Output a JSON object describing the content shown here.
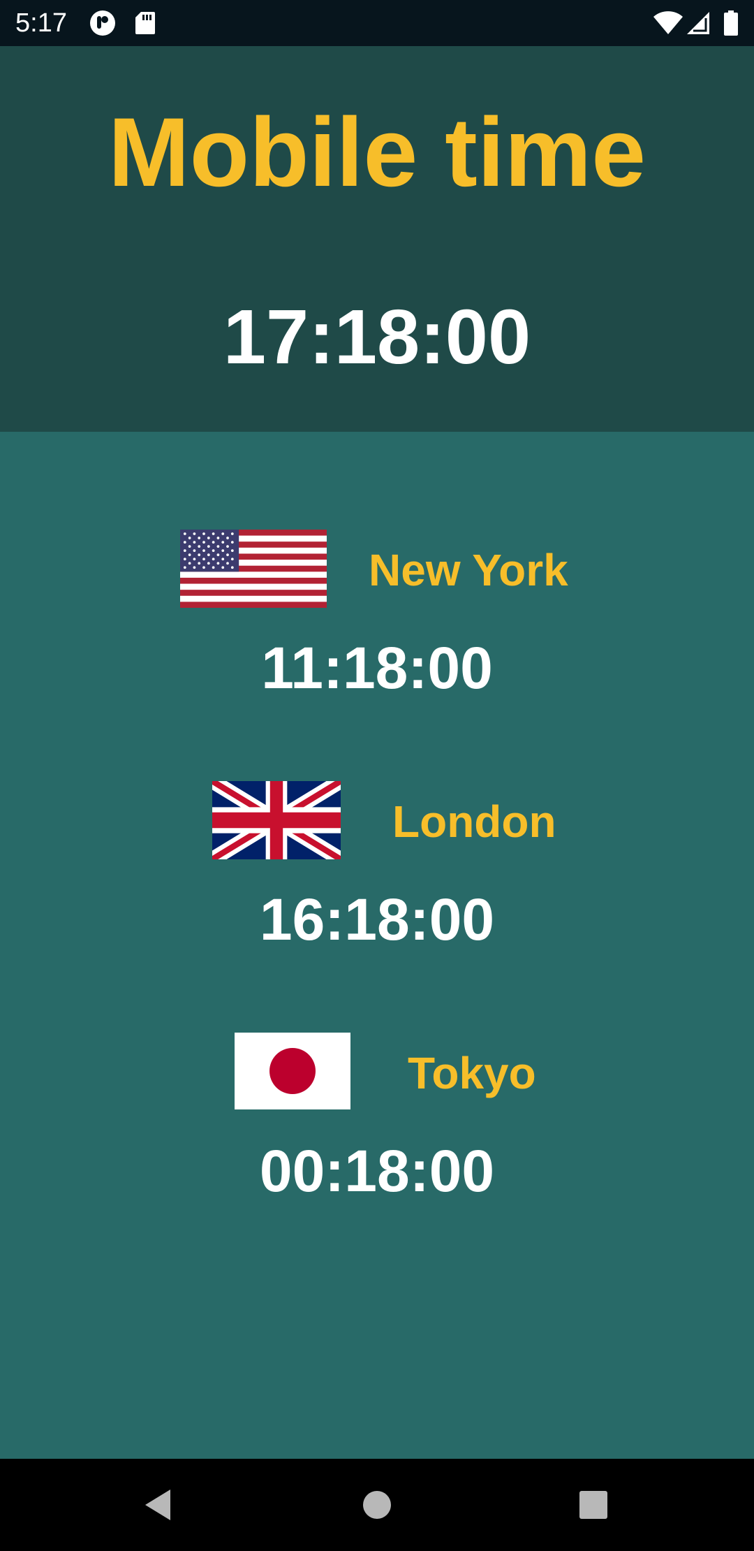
{
  "status_bar": {
    "time": "5:17",
    "icons": [
      "notification-app-icon",
      "sd-card-icon",
      "wifi-icon",
      "cell-signal-icon",
      "battery-icon"
    ]
  },
  "header": {
    "title": "Mobile time",
    "local_time": "17:18:00"
  },
  "cities": [
    {
      "name": "New York",
      "time": "11:18:00",
      "flag": "us-flag-icon"
    },
    {
      "name": "London",
      "time": "16:18:00",
      "flag": "uk-flag-icon"
    },
    {
      "name": "Tokyo",
      "time": "00:18:00",
      "flag": "japan-flag-icon"
    }
  ],
  "nav_bar": {
    "icons": [
      "back-icon",
      "home-icon",
      "recents-icon"
    ]
  },
  "colors": {
    "accent": "#f7be2a",
    "header_bg": "#1f4a48",
    "body_bg": "#286a68",
    "text": "#ffffff"
  }
}
